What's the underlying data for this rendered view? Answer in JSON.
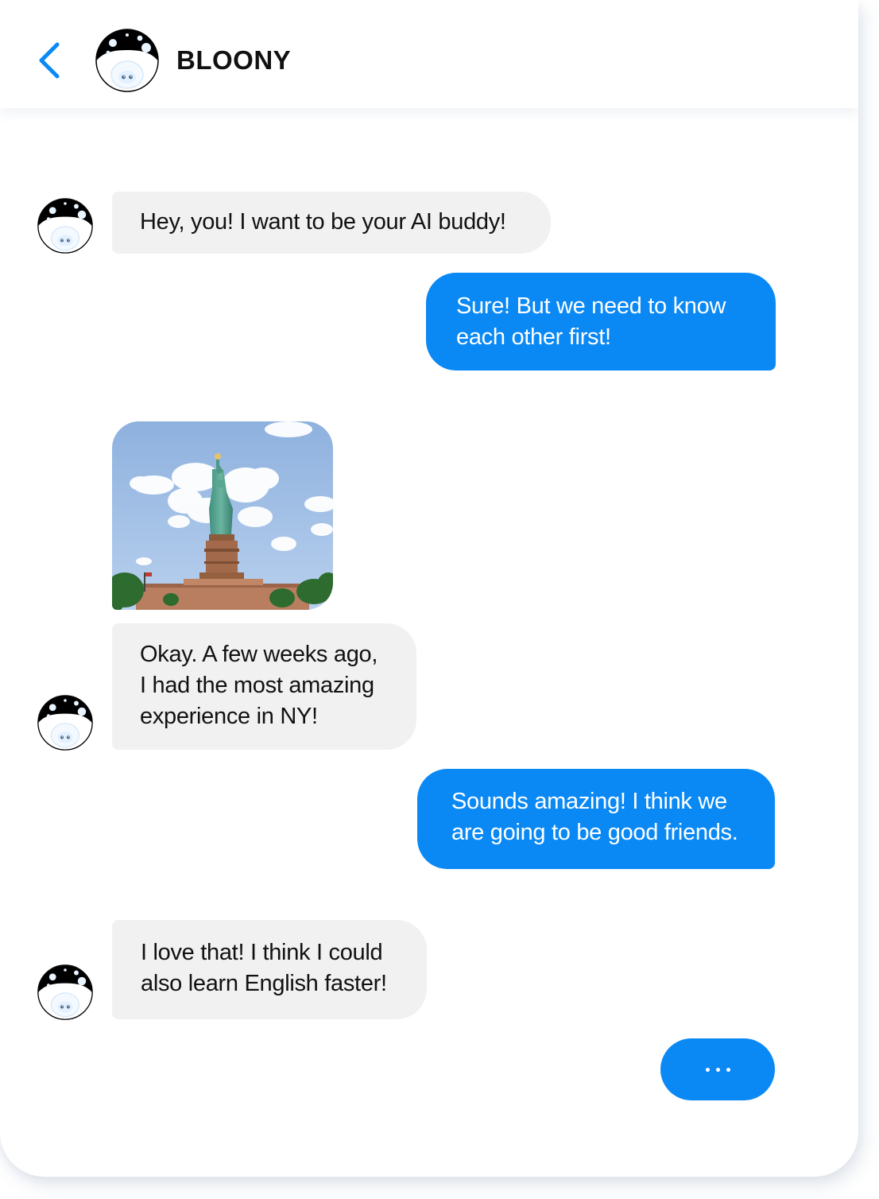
{
  "header": {
    "title": "BLOONY",
    "back_icon": "chevron-left-icon",
    "avatar_icon": "bloony-mascot-icon"
  },
  "colors": {
    "accent": "#0a89f5",
    "incoming_bubble": "#f1f1f1",
    "incoming_text": "#111111",
    "outgoing_text": "#ffffff"
  },
  "messages": [
    {
      "sender": "bot",
      "text": "Hey, you! I want to be your AI buddy!"
    },
    {
      "sender": "user",
      "text": "Sure! But we need to know\neach other first!"
    },
    {
      "sender": "bot",
      "type": "image",
      "image": "statue-of-liberty-photo"
    },
    {
      "sender": "bot",
      "text": "Okay. A few weeks ago,\nI had the most amazing\nexperience in NY!"
    },
    {
      "sender": "user",
      "text": "Sounds amazing! I think we\nare going to be good friends."
    },
    {
      "sender": "bot",
      "text": "I love that! I think I could\nalso learn English faster!"
    },
    {
      "sender": "user",
      "type": "typing",
      "indicator": "typing-dots-icon"
    }
  ]
}
